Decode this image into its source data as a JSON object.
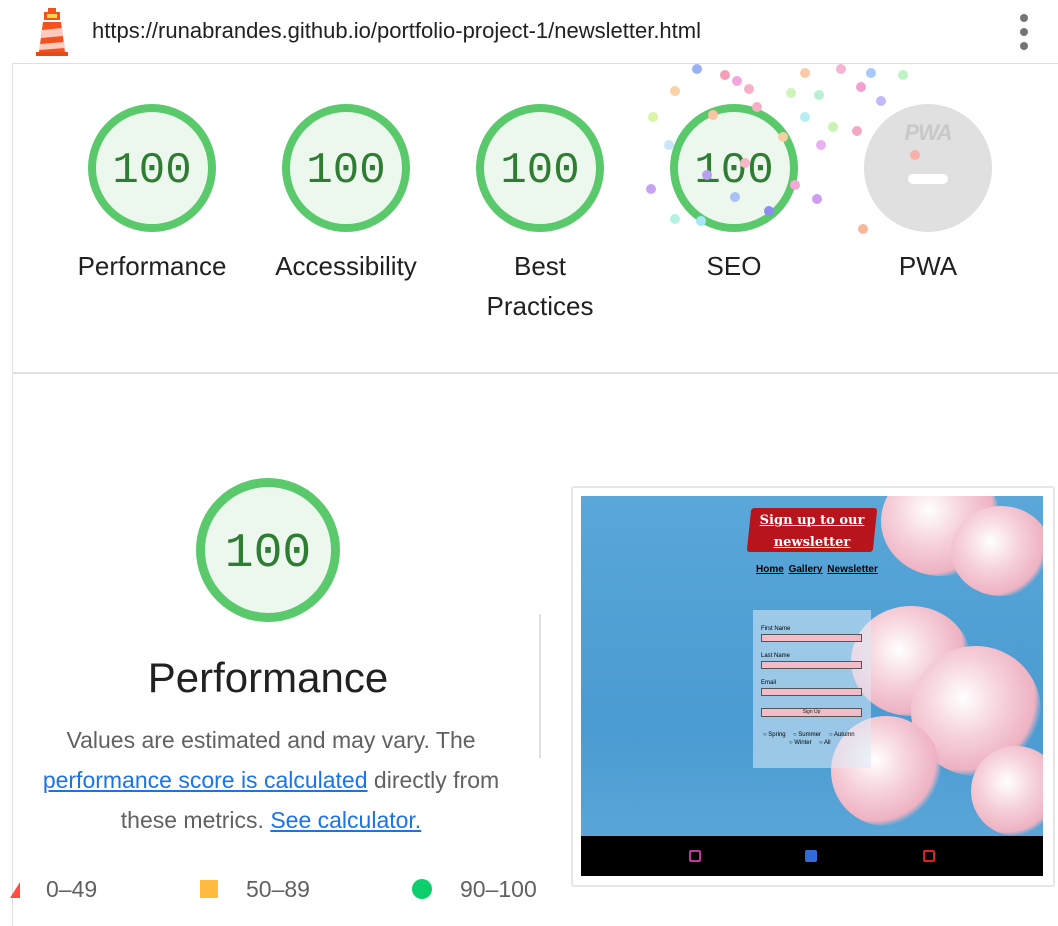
{
  "topbar": {
    "logo_icon": "lighthouse-icon",
    "url": "https://runabrandes.github.io/portfolio-project-1/newsletter.html",
    "menu_icon": "vertical-dots-icon"
  },
  "gauges": [
    {
      "score": "100",
      "label": "Performance"
    },
    {
      "score": "100",
      "label": "Accessibility"
    },
    {
      "score": "100",
      "label": "Best Practices"
    },
    {
      "score": "100",
      "label": "SEO"
    },
    {
      "score": "",
      "label": "PWA",
      "badge": "PWA"
    }
  ],
  "performance": {
    "score": "100",
    "title": "Performance",
    "desc_prefix": "Values are estimated and may vary. The",
    "link_text": "performance score is calculated",
    "desc_middle": "directly from these metrics.",
    "calculator_link": "See calculator."
  },
  "legend": {
    "fail": "0–49",
    "average": "50–89",
    "pass": "90–100"
  },
  "colors": {
    "pass": "#0cce6b",
    "pass_text": "#2e7d32",
    "average": "#ffa400",
    "fail": "#ff4e42",
    "link": "#1a73e8"
  },
  "thumbnail": {
    "banner": "Sign up to our newsletter",
    "nav": [
      "Home",
      "Gallery",
      "Newsletter"
    ],
    "form_labels": [
      "First Name",
      "Last Name",
      "Email"
    ],
    "button": "Sign Up",
    "options": [
      "Spring",
      "Summer",
      "Autumn",
      "Winter",
      "All"
    ],
    "footer_icons": [
      "instagram-icon",
      "facebook-icon",
      "youtube-icon"
    ]
  }
}
